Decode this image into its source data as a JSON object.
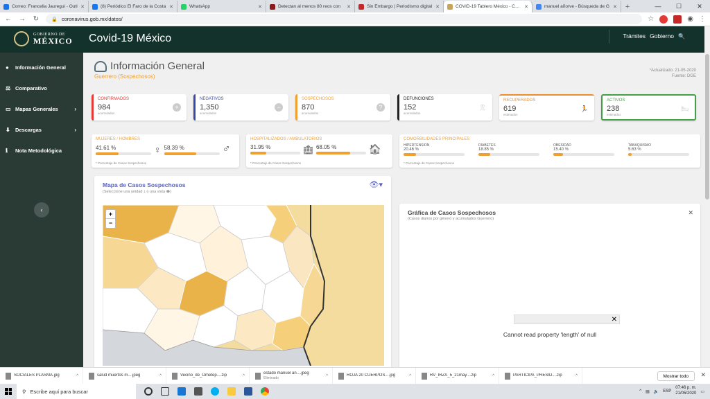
{
  "browser": {
    "tabs": [
      {
        "label": "Correo: Francelia Jauregui - Outl",
        "color": "#1a73e8",
        "active": false
      },
      {
        "label": "(8) Periódico El Faro de la Costa",
        "color": "#1877f2",
        "active": false
      },
      {
        "label": "WhatsApp",
        "color": "#25d366",
        "active": false
      },
      {
        "label": "Detectan al menos 80 reos con",
        "color": "#8b1a1a",
        "active": false
      },
      {
        "label": "Sin Embargo | Periodismo digital",
        "color": "#c62828",
        "active": false
      },
      {
        "label": "COVID-19 Tablero México - COVID",
        "color": "#c8a45a",
        "active": true
      },
      {
        "label": "manuel añorve - Búsqueda de G",
        "color": "#4285f4",
        "active": false
      }
    ],
    "url": "coronavirus.gob.mx/datos/",
    "new_tab": "+",
    "controls": {
      "minimize": "—",
      "maximize": "☐",
      "close": "✕"
    },
    "nav": {
      "back": "←",
      "forward": "→",
      "reload": "↻"
    }
  },
  "header": {
    "logo_line1": "GOBIERNO DE",
    "logo_line2": "MÉXICO",
    "app_title": "Covid-19 México",
    "nav_items": [
      "Trámites",
      "Gobierno"
    ],
    "search_icon": "🔍"
  },
  "sidebar": {
    "items": [
      {
        "label": "Información General",
        "icon": "●",
        "has_chevron": false
      },
      {
        "label": "Comparativo",
        "icon": "⚖",
        "has_chevron": false
      },
      {
        "label": "Mapas Generales",
        "icon": "▭",
        "has_chevron": true
      },
      {
        "label": "Descargas",
        "icon": "⬇",
        "has_chevron": true
      },
      {
        "label": "Nota Metodológica",
        "icon": "ℹ",
        "has_chevron": false
      }
    ],
    "chevron": "›",
    "collapse_icon": "‹"
  },
  "page": {
    "title": "Información General",
    "subtitle": "Guerrero (Sospechosos)",
    "updated": "*Actualizado: 21-05-2020",
    "source": "Fuente: DGE"
  },
  "kpis": [
    {
      "label": "CONFIRMADOS",
      "value": "984",
      "sub": "acumulados",
      "color": "#e53935",
      "icon": "+"
    },
    {
      "label": "NEGATIVOS",
      "value": "1,350",
      "sub": "acumulados",
      "color": "#3949ab",
      "icon": "−"
    },
    {
      "label": "SOSPECHOSOS",
      "value": "870",
      "sub": "acumulados",
      "color": "#f0a030",
      "icon": "?"
    },
    {
      "label": "DEFUNCIONES",
      "value": "152",
      "sub": "acumulados",
      "color": "#222222",
      "icon": "🎗"
    },
    {
      "label": "RECUPERADOS",
      "value": "619",
      "sub": "estimados",
      "color": "#ef8c2c",
      "icon": "🏃"
    },
    {
      "label": "ACTIVOS",
      "value": "238",
      "sub": "estimados",
      "color": "#43a047",
      "icon": "🛏"
    }
  ],
  "gender": {
    "title": "MUJERES / HOMBRES",
    "women_pct": "41.61 %",
    "men_pct": "58.39 %",
    "women_fill": 41.61,
    "men_fill": 58.39,
    "note": "* Porcentaje de Casos Sospechosos",
    "women_icon": "♀",
    "men_icon": "♂"
  },
  "hospital": {
    "title": "HOSPITALIZADOS / AMBULATORIOS",
    "hosp_pct": "31.95 %",
    "amb_pct": "68.05 %",
    "hosp_fill": 31.95,
    "amb_fill": 68.05,
    "note": "* Porcentaje de Casos Sospechosos",
    "hosp_icon": "🏥",
    "amb_icon": "🏠"
  },
  "comorbidities": {
    "title": "COMORBILIDADES PRINCIPALES",
    "items": [
      {
        "label": "HIPERTENSION",
        "value": "20.46 %",
        "fill": 20.46
      },
      {
        "label": "DIABETES",
        "value": "18.85 %",
        "fill": 18.85
      },
      {
        "label": "OBESIDAD",
        "value": "15.40 %",
        "fill": 15.4
      },
      {
        "label": "TABAQUISMO",
        "value": "5.63 %",
        "fill": 5.63
      }
    ],
    "note": "* Porcentaje de Casos Sospechosos"
  },
  "map_panel": {
    "title": "Mapa de Casos Sospechosos",
    "subtitle": "(Seleccione una unidad 🡓 o una vista 👁)",
    "zoom_in": "+",
    "zoom_out": "−",
    "view_icon": "👁▾"
  },
  "chart_panel": {
    "title": "Gráfica de Casos Sospechosos",
    "subtitle": "(Casos diarios por género y acumulados Guerrero)",
    "close": "✕",
    "error": "Cannot read property 'length' of null",
    "error_close": "✕"
  },
  "downloads": {
    "items": [
      {
        "name": "SOCIALES PLASMA.jpg",
        "sub": ""
      },
      {
        "name": "salud muertos m....jpeg",
        "sub": ""
      },
      {
        "name": "Vecino_de_Ometep....zip",
        "sub": ""
      },
      {
        "name": "estado manuel añ....jpeg",
        "sub": "Eliminado"
      },
      {
        "name": "ROJA 20 CUERPOS....jpg",
        "sub": ""
      },
      {
        "name": "RV_IRZA_5_21may....zip",
        "sub": ""
      },
      {
        "name": "PARTICIPA_PRESID....zip",
        "sub": ""
      }
    ],
    "show_all": "Mostrar todo",
    "close": "✕",
    "chevron": "^"
  },
  "taskbar": {
    "search_placeholder": "Escribe aquí para buscar",
    "time": "07:46 p. m.",
    "date": "21/05/2020",
    "lang": "ESP"
  }
}
